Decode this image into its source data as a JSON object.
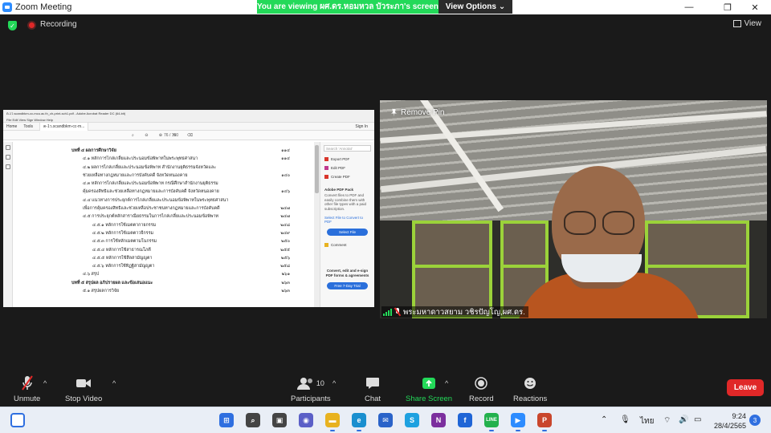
{
  "window": {
    "title": "Zoom Meeting",
    "controls": [
      "—",
      "❐",
      "✕"
    ]
  },
  "share_banner": {
    "viewing_text": "You are viewing ผศ.ดร.หอมหวล บัวระภา's screen",
    "view_options_label": "View Options",
    "caret": "⌄"
  },
  "meeting_header": {
    "recording_label": "Recording",
    "view_label": "View",
    "shield_glyph": "✓"
  },
  "shared_screen": {
    "app_title": "ต-1ว.scandbkm-cc-mcu.ac.th_ch-print-sch1.pdf - Adobe Acrobat Reader DC (64-bit)",
    "menu": "File   Edit   View   Sign   Window   Help",
    "tabs": [
      "Home",
      "Tools",
      "ต-1ว.scandbkm-cc-m..."
    ],
    "sign_in": "Sign In",
    "page_indicator": "76  /  100",
    "toolbar_icons": "⌕ ⊖ ⊕ ✎ ⌫",
    "toc": [
      {
        "text": "บทที่ ๔  ผลการศึกษาวิจัย",
        "page": "๑๑๔",
        "indent": 0,
        "head": true
      },
      {
        "text": "๔.๑  หลักการไกล่เกลี่ยและประนอมข้อพิพาทในพระพุทธศาสนา",
        "page": "๑๑๔",
        "indent": 1
      },
      {
        "text": "๔.๒  ผลการไกล่เกลี่ยและประนอมข้อพิพาท สำนักงานยุติธรรมจังหวัดและ",
        "page": "",
        "indent": 1
      },
      {
        "text": "ช่วยเหลือทางกฎหมายและการบังคับคดี จังหวัดหนองคาย",
        "page": "๑๔๐",
        "indent": 1
      },
      {
        "text": "๔.๓  หลักการไกล่เกลี่ยและประนอมข้อพิพาท กรณีศึกษาสำนักงานยุติธรรม",
        "page": "",
        "indent": 1
      },
      {
        "text": "คุ้มครองสิทธิและช่วยเหลือทางกฎหมายและการบังคับคดี จังหวัดหนองคาย",
        "page": "๑๔๖",
        "indent": 1
      },
      {
        "text": "๔.๔  แนวทางการประยุกต์การไกล่เกลี่ยและประนอมข้อพิพาทในพระพุทธศาสนา",
        "page": "",
        "indent": 1
      },
      {
        "text": "เพื่อการคุ้มครองสิทธิและช่วยเหลือประชาชนทางกฎหมายและการบังคับคดี",
        "page": "๒๔๗",
        "indent": 1
      },
      {
        "text": "๔.๕  การประยุกต์หลักสาราณียธรรมในการไกล่เกลี่ยและประนอมข้อพิพาท",
        "page": "๒๔๗",
        "indent": 1
      },
      {
        "text": "๔.๕.๑  หลักการใช้เมตตากายกรรม",
        "page": "๒๔๘",
        "indent": 2
      },
      {
        "text": "๔.๕.๒  หลักการใช้เมตตาวจีกรรม",
        "page": "๒๔๙",
        "indent": 2
      },
      {
        "text": "๔.๕.๓  การใช้หลักเมตตามโนกรรม",
        "page": "๒๕๐",
        "indent": 2
      },
      {
        "text": "๔.๕.๔  หลักการใช้สาธารณโภคี",
        "page": "๒๕๕",
        "indent": 2
      },
      {
        "text": "๔.๕.๕  หลักการใช้สีลสามัญญตา",
        "page": "๒๕๖",
        "indent": 2
      },
      {
        "text": "๔.๕.๖  หลักการใช้ทิฏฐิสามัญญตา",
        "page": "๒๕๘",
        "indent": 2
      },
      {
        "text": "๔.๖  สรุป",
        "page": "๒๖๑",
        "indent": 1
      },
      {
        "text": "บทที่ ๕  สรุปผล อภิปรายผล  และข้อเสนอแนะ",
        "page": "๒๖๓",
        "indent": 0,
        "head": true
      },
      {
        "text": "๕.๑  สรุปผลการวิจัย",
        "page": "๒๖๓",
        "indent": 1
      }
    ],
    "right_panel": {
      "search_placeholder": "Search 'Annotat'",
      "tools": [
        {
          "label": "Export PDF",
          "color": "#d9362b"
        },
        {
          "label": "Edit PDF",
          "color": "#c0398f"
        },
        {
          "label": "Create PDF",
          "color": "#d9362b"
        }
      ],
      "pack_title": "Adobe PDF Pack",
      "pack_desc": "Convert files to PDF and easily combine them with other file types with a paid subscription.",
      "convert_link": "Select File to Convert to PDF",
      "select_file_label": "Select File",
      "comment_label": "Comment",
      "promo": "Convert, edit and e-sign PDF forms & agreements",
      "trial_label": "Free 7-Day Trial"
    }
  },
  "video": {
    "remove_pin_label": "Remove Pin",
    "participant_name": "พระมหาดาวสยาม วชิรปัญโญ,ผศ.ดร."
  },
  "toolbar": {
    "unmute_label": "Unmute",
    "stop_video_label": "Stop Video",
    "participants_label": "Participants",
    "participants_count": "10",
    "chat_label": "Chat",
    "share_screen_label": "Share Screen",
    "record_label": "Record",
    "reactions_label": "Reactions",
    "leave_label": "Leave",
    "caret": "^"
  },
  "taskbar": {
    "apps": [
      {
        "name": "start",
        "color": "#2f6fe0",
        "glyph": "⊞"
      },
      {
        "name": "search",
        "color": "#444",
        "glyph": "⌕"
      },
      {
        "name": "task-view",
        "color": "#444",
        "glyph": "▣"
      },
      {
        "name": "teams-chat",
        "color": "#5b5fc7",
        "glyph": "◉"
      },
      {
        "name": "file-explorer",
        "color": "#e8b220",
        "glyph": "▬"
      },
      {
        "name": "edge",
        "color": "#1a8fcf",
        "glyph": "e"
      },
      {
        "name": "mail",
        "color": "#2a63c9",
        "glyph": "✉"
      },
      {
        "name": "skype",
        "color": "#1ea1e0",
        "glyph": "S"
      },
      {
        "name": "onenote",
        "color": "#7b2f9e",
        "glyph": "N"
      },
      {
        "name": "facebook",
        "color": "#1f65d6",
        "glyph": "f"
      },
      {
        "name": "line",
        "color": "#23b14d",
        "glyph": "LINE"
      },
      {
        "name": "zoom",
        "color": "#2d8cff",
        "glyph": "▶"
      },
      {
        "name": "powerpoint",
        "color": "#c9462c",
        "glyph": "P"
      }
    ],
    "lang": "ไทย",
    "time": "9:24",
    "date": "28/4/2565",
    "notification_count": "3"
  }
}
